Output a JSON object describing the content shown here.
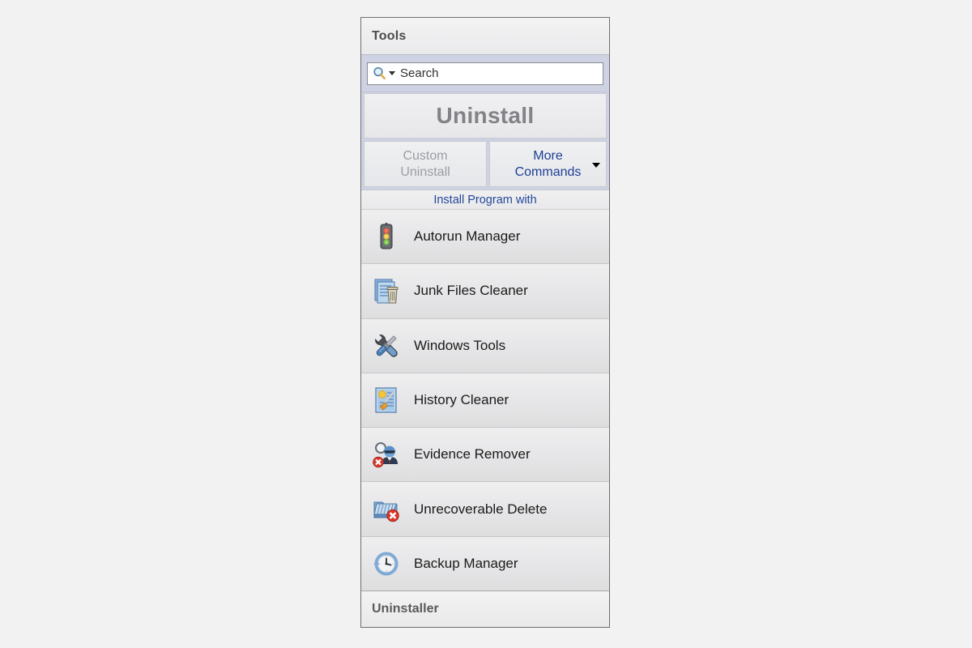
{
  "window": {
    "title": "Tools"
  },
  "search": {
    "icon": "search-icon",
    "dropdown_icon": "chevron-down-icon",
    "placeholder": "Search",
    "value": ""
  },
  "actions": {
    "uninstall_label": "Uninstall",
    "uninstall_disabled": true,
    "custom_uninstall_line1": "Custom",
    "custom_uninstall_line2": "Uninstall",
    "custom_uninstall_disabled": true,
    "more_commands_line1": "More",
    "more_commands_line2": "Commands",
    "more_commands_caret": "caret-down-icon"
  },
  "install_with": {
    "label": "Install Program with"
  },
  "tools": [
    {
      "label": "Autorun Manager",
      "icon": "traffic-light-icon"
    },
    {
      "label": "Junk Files Cleaner",
      "icon": "documents-trash-icon"
    },
    {
      "label": "Windows Tools",
      "icon": "wrench-screwdriver-icon"
    },
    {
      "label": "History Cleaner",
      "icon": "document-broom-icon"
    },
    {
      "label": "Evidence Remover",
      "icon": "spy-magnifier-delete-icon"
    },
    {
      "label": "Unrecoverable Delete",
      "icon": "shredder-delete-icon"
    },
    {
      "label": "Backup Manager",
      "icon": "clock-restore-icon"
    }
  ],
  "footer": {
    "label": "Uninstaller"
  },
  "colors": {
    "accent_link": "#23479b",
    "more_commands_text": "#1c3f94",
    "disabled_text": "#9d9da2",
    "band": "#ced2e2",
    "panel_bg": "#e9e9eb",
    "border": "#6f6f6f"
  }
}
